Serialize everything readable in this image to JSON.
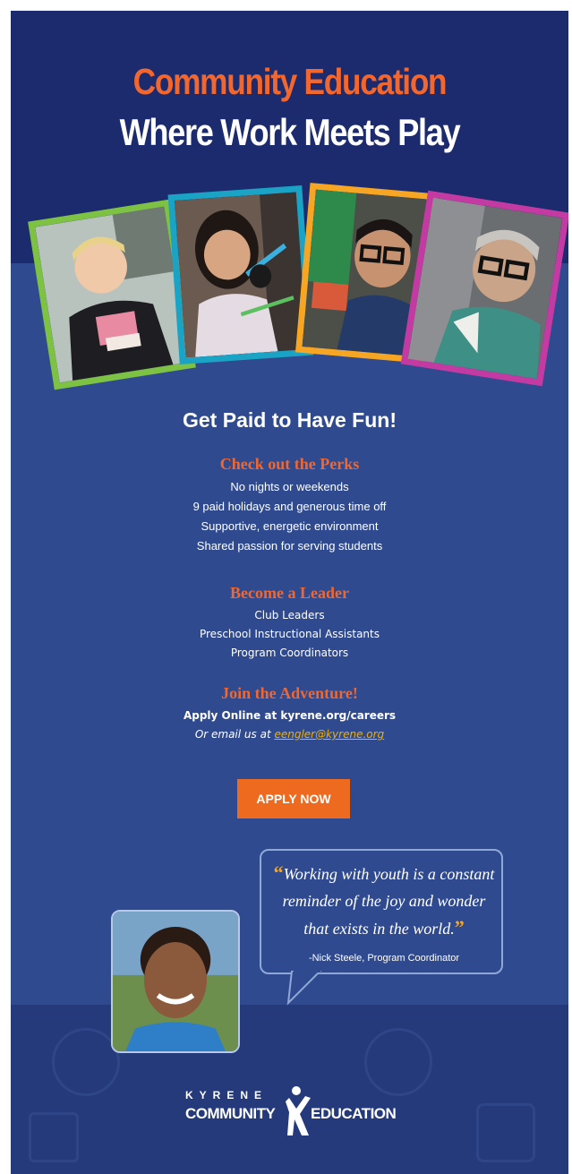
{
  "header": {
    "title_line1": "Community Education",
    "title_line2": "Where Work Meets Play"
  },
  "headline": "Get Paid to Have Fun!",
  "perks": {
    "title": "Check out the Perks",
    "items": [
      "No nights or weekends",
      "9 paid holidays and generous time off",
      "Supportive, energetic environment",
      "Shared passion for serving students"
    ]
  },
  "leader": {
    "title": "Become a Leader",
    "items": [
      "Club Leaders",
      "Preschool Instructional Assistants",
      "Program Coordinators"
    ]
  },
  "join": {
    "title": "Join the Adventure!",
    "apply_line": "Apply Online at kyrene.org/careers",
    "email_prefix": "Or email us at ",
    "email": "eengler@kyrene.org"
  },
  "cta": {
    "label": "APPLY NOW"
  },
  "quote": {
    "line1": "Working with youth is a constant",
    "line2": "reminder of the joy and wonder",
    "line3": "that exists in the world.",
    "attribution": "-Nick Steele, Program Coordinator"
  },
  "logo": {
    "top": "KYRENE",
    "left": "COMMUNITY",
    "right": "EDUCATION"
  },
  "colors": {
    "navy": "#1c2a6e",
    "blue": "#2f4a8f",
    "orange": "#f2672e",
    "button": "#ee6a1e",
    "frame_green": "#7dc242",
    "frame_teal": "#1aa3c4",
    "frame_yellow": "#f6a623",
    "frame_magenta": "#c43aa3"
  }
}
